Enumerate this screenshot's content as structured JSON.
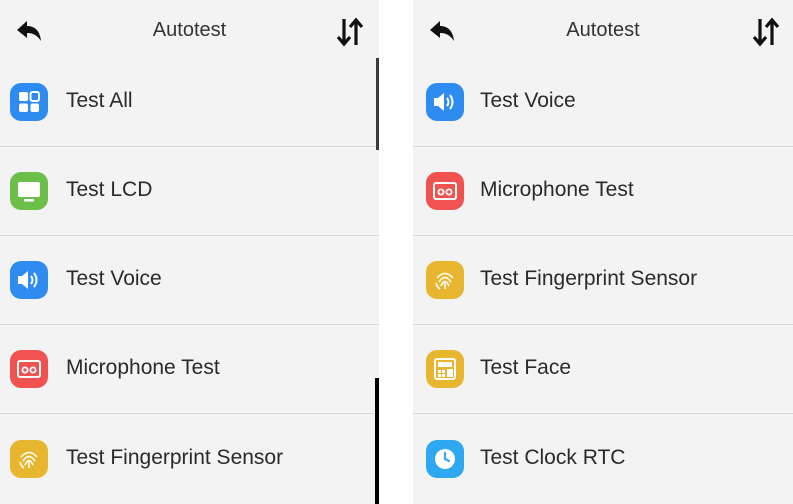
{
  "left": {
    "title": "Autotest",
    "items": [
      {
        "label": "Test All",
        "icon": "grid-icon",
        "color": "#2e8cf0"
      },
      {
        "label": "Test LCD",
        "icon": "monitor-icon",
        "color": "#6cc04a"
      },
      {
        "label": "Test Voice",
        "icon": "speaker-icon",
        "color": "#2e8cf0"
      },
      {
        "label": "Microphone Test",
        "icon": "microphone-icon",
        "color": "#f0524f"
      },
      {
        "label": "Test Fingerprint Sensor",
        "icon": "fingerprint-icon",
        "color": "#e8b62e"
      }
    ]
  },
  "right": {
    "title": "Autotest",
    "items": [
      {
        "label": "Test Voice",
        "icon": "speaker-icon",
        "color": "#2e8cf0"
      },
      {
        "label": "Microphone Test",
        "icon": "microphone-icon",
        "color": "#f0524f"
      },
      {
        "label": "Test Fingerprint Sensor",
        "icon": "fingerprint-icon",
        "color": "#e8b62e"
      },
      {
        "label": "Test Face",
        "icon": "face-icon",
        "color": "#e8b62e"
      },
      {
        "label": "Test Clock RTC",
        "icon": "clock-icon",
        "color": "#2ea8f0"
      }
    ]
  }
}
